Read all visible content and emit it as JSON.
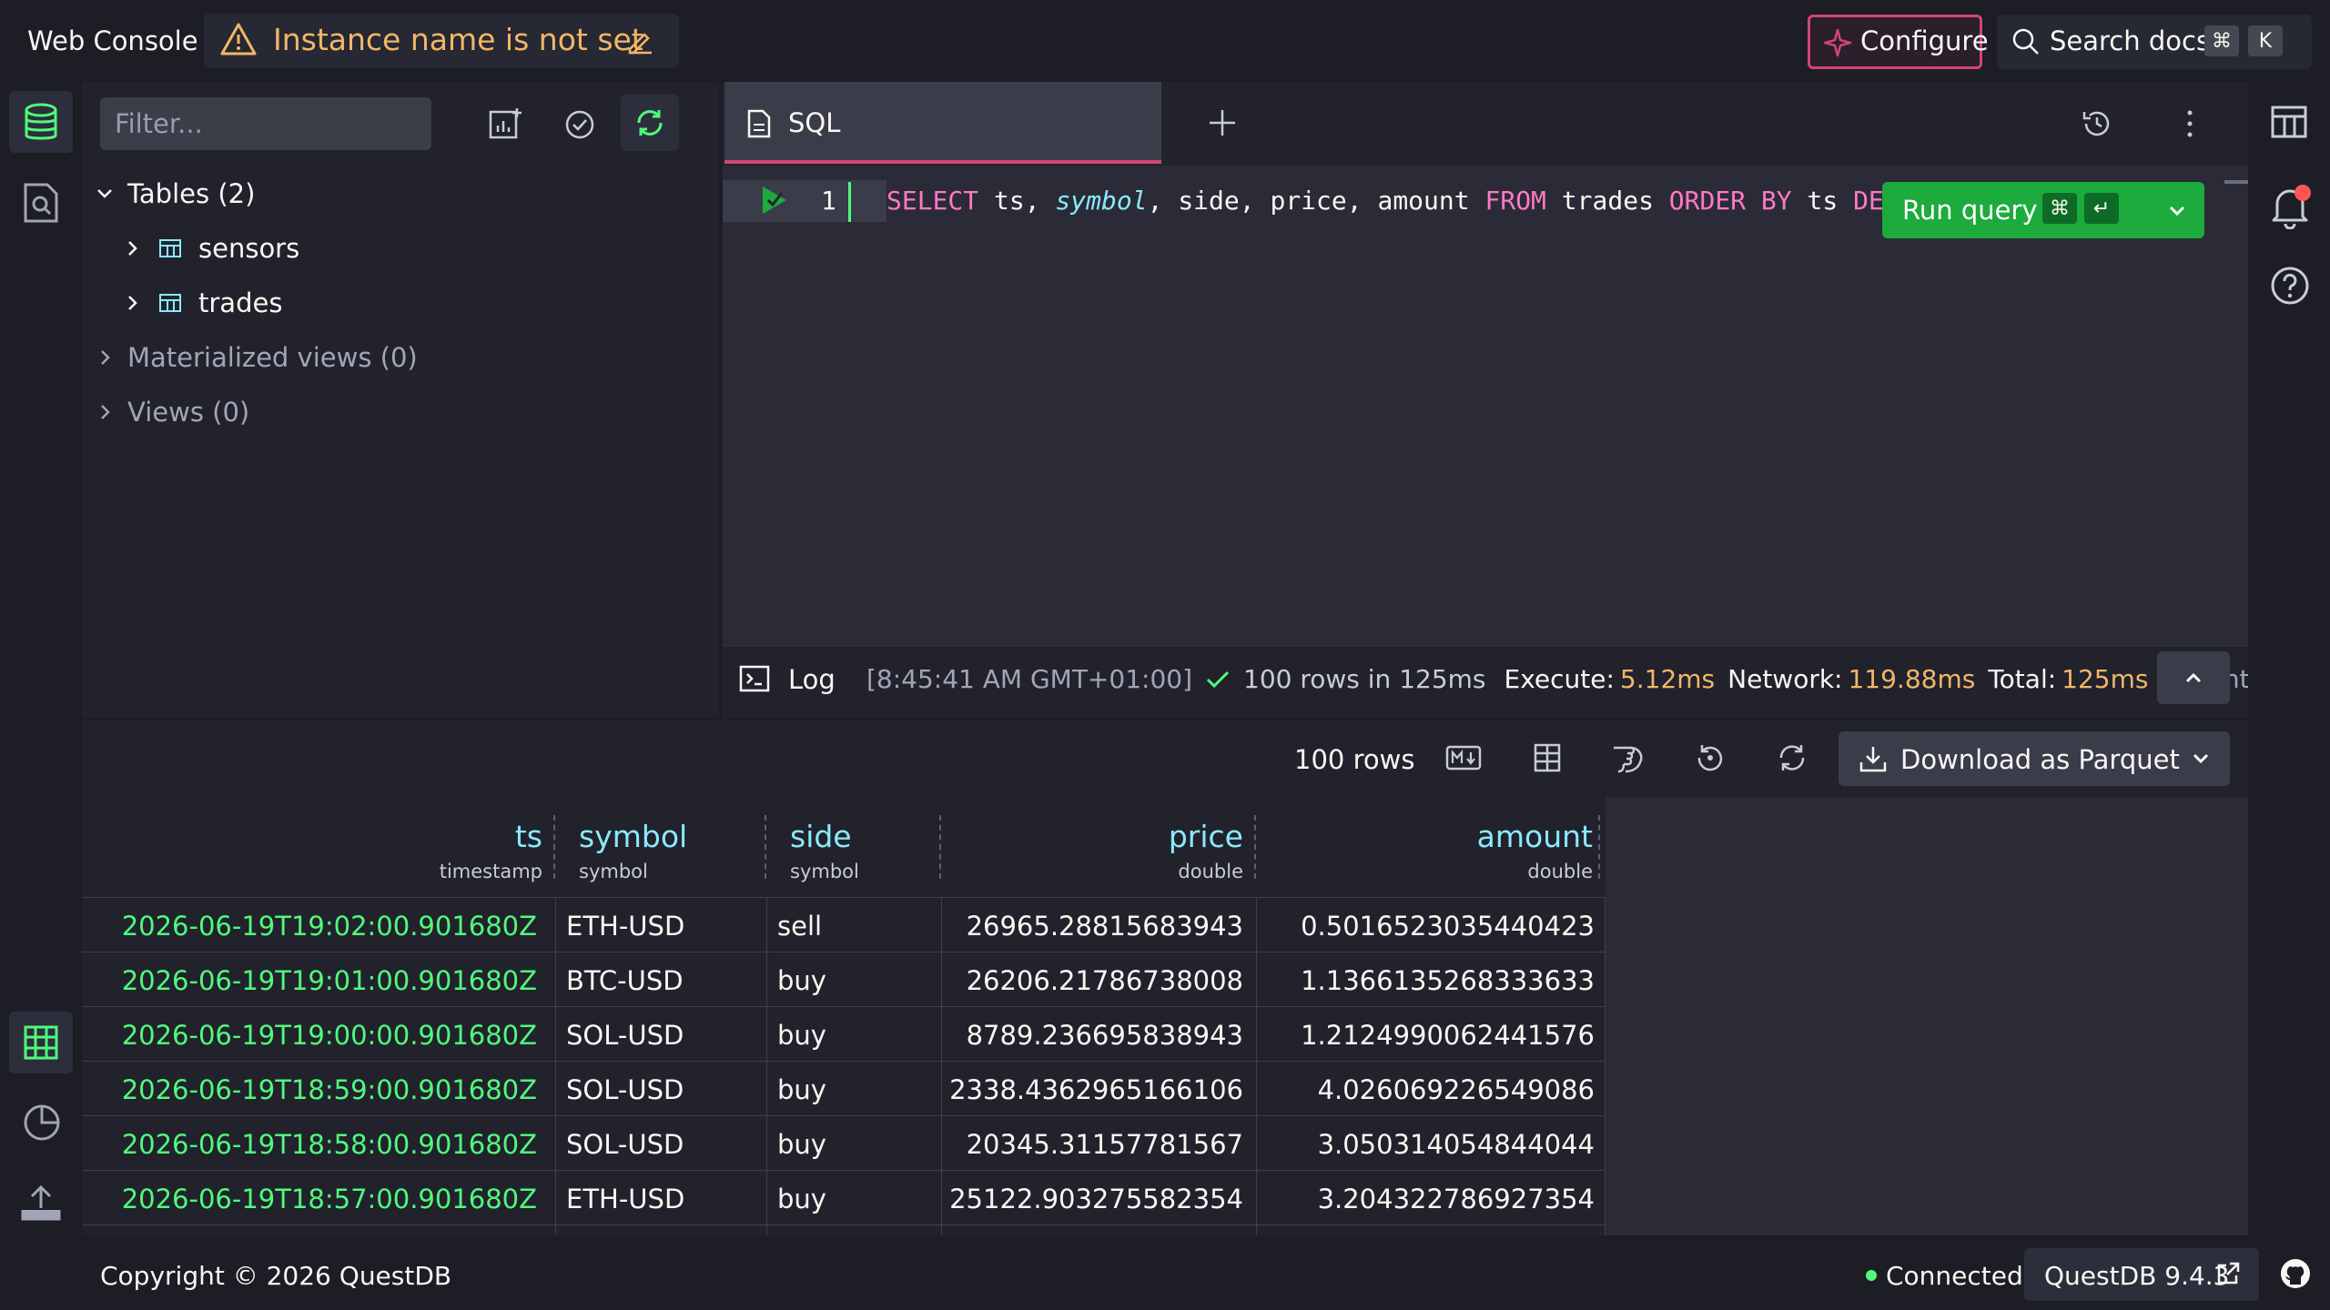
{
  "app": {
    "title": "Web Console",
    "instance_warning": "Instance name is not set",
    "configure_label": "Configure",
    "search_label": "Search docs",
    "search_keys": [
      "⌘",
      "K"
    ]
  },
  "schema": {
    "filter_placeholder": "Filter...",
    "tables_label": "Tables (2)",
    "tables": [
      "sensors",
      "trades"
    ],
    "materialized_views_label": "Materialized views (0)",
    "views_label": "Views (0)"
  },
  "editor": {
    "tab_label": "SQL",
    "line_number": "1",
    "query_parts": {
      "k1": "SELECT",
      "t1": " ts, ",
      "i1": "symbol",
      "t2": ", side, price, amount ",
      "k2": "FROM",
      "t3": " trades ",
      "k3": "ORDER BY",
      "t4": " ts ",
      "k4": "DE"
    },
    "run_label": "Run query",
    "run_keys": [
      "⌘",
      "↵"
    ]
  },
  "log": {
    "label": "Log",
    "time": "[8:45:41 AM GMT+01:00]",
    "summary": "100 rows in 125ms",
    "execute_label": "Execute:",
    "execute_value": "5.12ms",
    "network_label": "Network:",
    "network_value": "119.88ms",
    "total_label": "Total:",
    "total_value": "125ms",
    "count_label": "Count:"
  },
  "results": {
    "row_count": "100 rows",
    "download_label": "Download as Parquet",
    "columns": [
      {
        "name": "ts",
        "type": "timestamp"
      },
      {
        "name": "symbol",
        "type": "symbol"
      },
      {
        "name": "side",
        "type": "symbol"
      },
      {
        "name": "price",
        "type": "double"
      },
      {
        "name": "amount",
        "type": "double"
      }
    ],
    "rows": [
      [
        "2026-06-19T19:02:00.901680Z",
        "ETH-USD",
        "sell",
        "26965.28815683943",
        "0.5016523035440423"
      ],
      [
        "2026-06-19T19:01:00.901680Z",
        "BTC-USD",
        "buy",
        "26206.21786738008",
        "1.1366135268333633"
      ],
      [
        "2026-06-19T19:00:00.901680Z",
        "SOL-USD",
        "buy",
        "8789.236695838943",
        "1.2124990062441576"
      ],
      [
        "2026-06-19T18:59:00.901680Z",
        "SOL-USD",
        "buy",
        "2338.4362965166106",
        "4.026069226549086"
      ],
      [
        "2026-06-19T18:58:00.901680Z",
        "SOL-USD",
        "buy",
        "20345.31157781567",
        "3.050314054844044"
      ],
      [
        "2026-06-19T18:57:00.901680Z",
        "ETH-USD",
        "buy",
        "25122.903275582354",
        "3.204322786927354"
      ]
    ]
  },
  "footer": {
    "copyright": "Copyright © 2026 QuestDB",
    "status": "Connected",
    "version": "QuestDB 9.4.3"
  },
  "colors": {
    "accent_pink": "#d14671",
    "run_green": "#1cab3c",
    "timestamp_green": "#50fa7b",
    "header_cyan": "#8be9fd",
    "warning_orange": "#f2b766"
  }
}
